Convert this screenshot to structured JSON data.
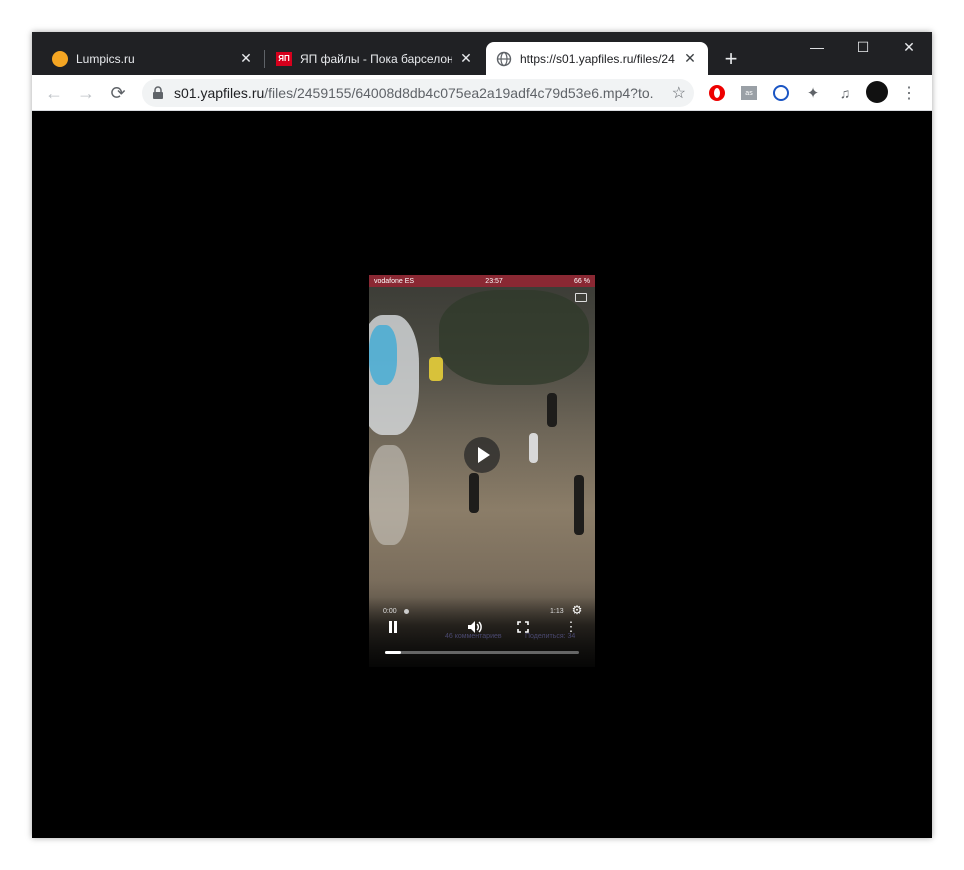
{
  "browser": {
    "tabs": [
      {
        "title": "Lumpics.ru",
        "favicon": "orange-circle-icon",
        "active": false
      },
      {
        "title": "ЯП файлы - Пока барселонц",
        "favicon": "yap-logo-icon",
        "active": false
      },
      {
        "title": "https://s01.yapfiles.ru/files/24",
        "favicon": "globe-icon",
        "active": true
      }
    ],
    "address": {
      "host": "s01.yapfiles.ru",
      "path": "/files/2459155/64008d8db4c075ea2a19adf4c79d53e6.mp4?to..."
    }
  },
  "video": {
    "status_carrier": "vodafone ES",
    "status_time": "23:57",
    "status_battery": "66 %",
    "current_time": "0:00",
    "duration": "1:13",
    "progress": 0.08,
    "ghost_left": "46 комментариев",
    "ghost_right": "Поделиться: 34"
  },
  "colors": {
    "titlebar": "#202124",
    "statusbar": "#8a2833"
  }
}
